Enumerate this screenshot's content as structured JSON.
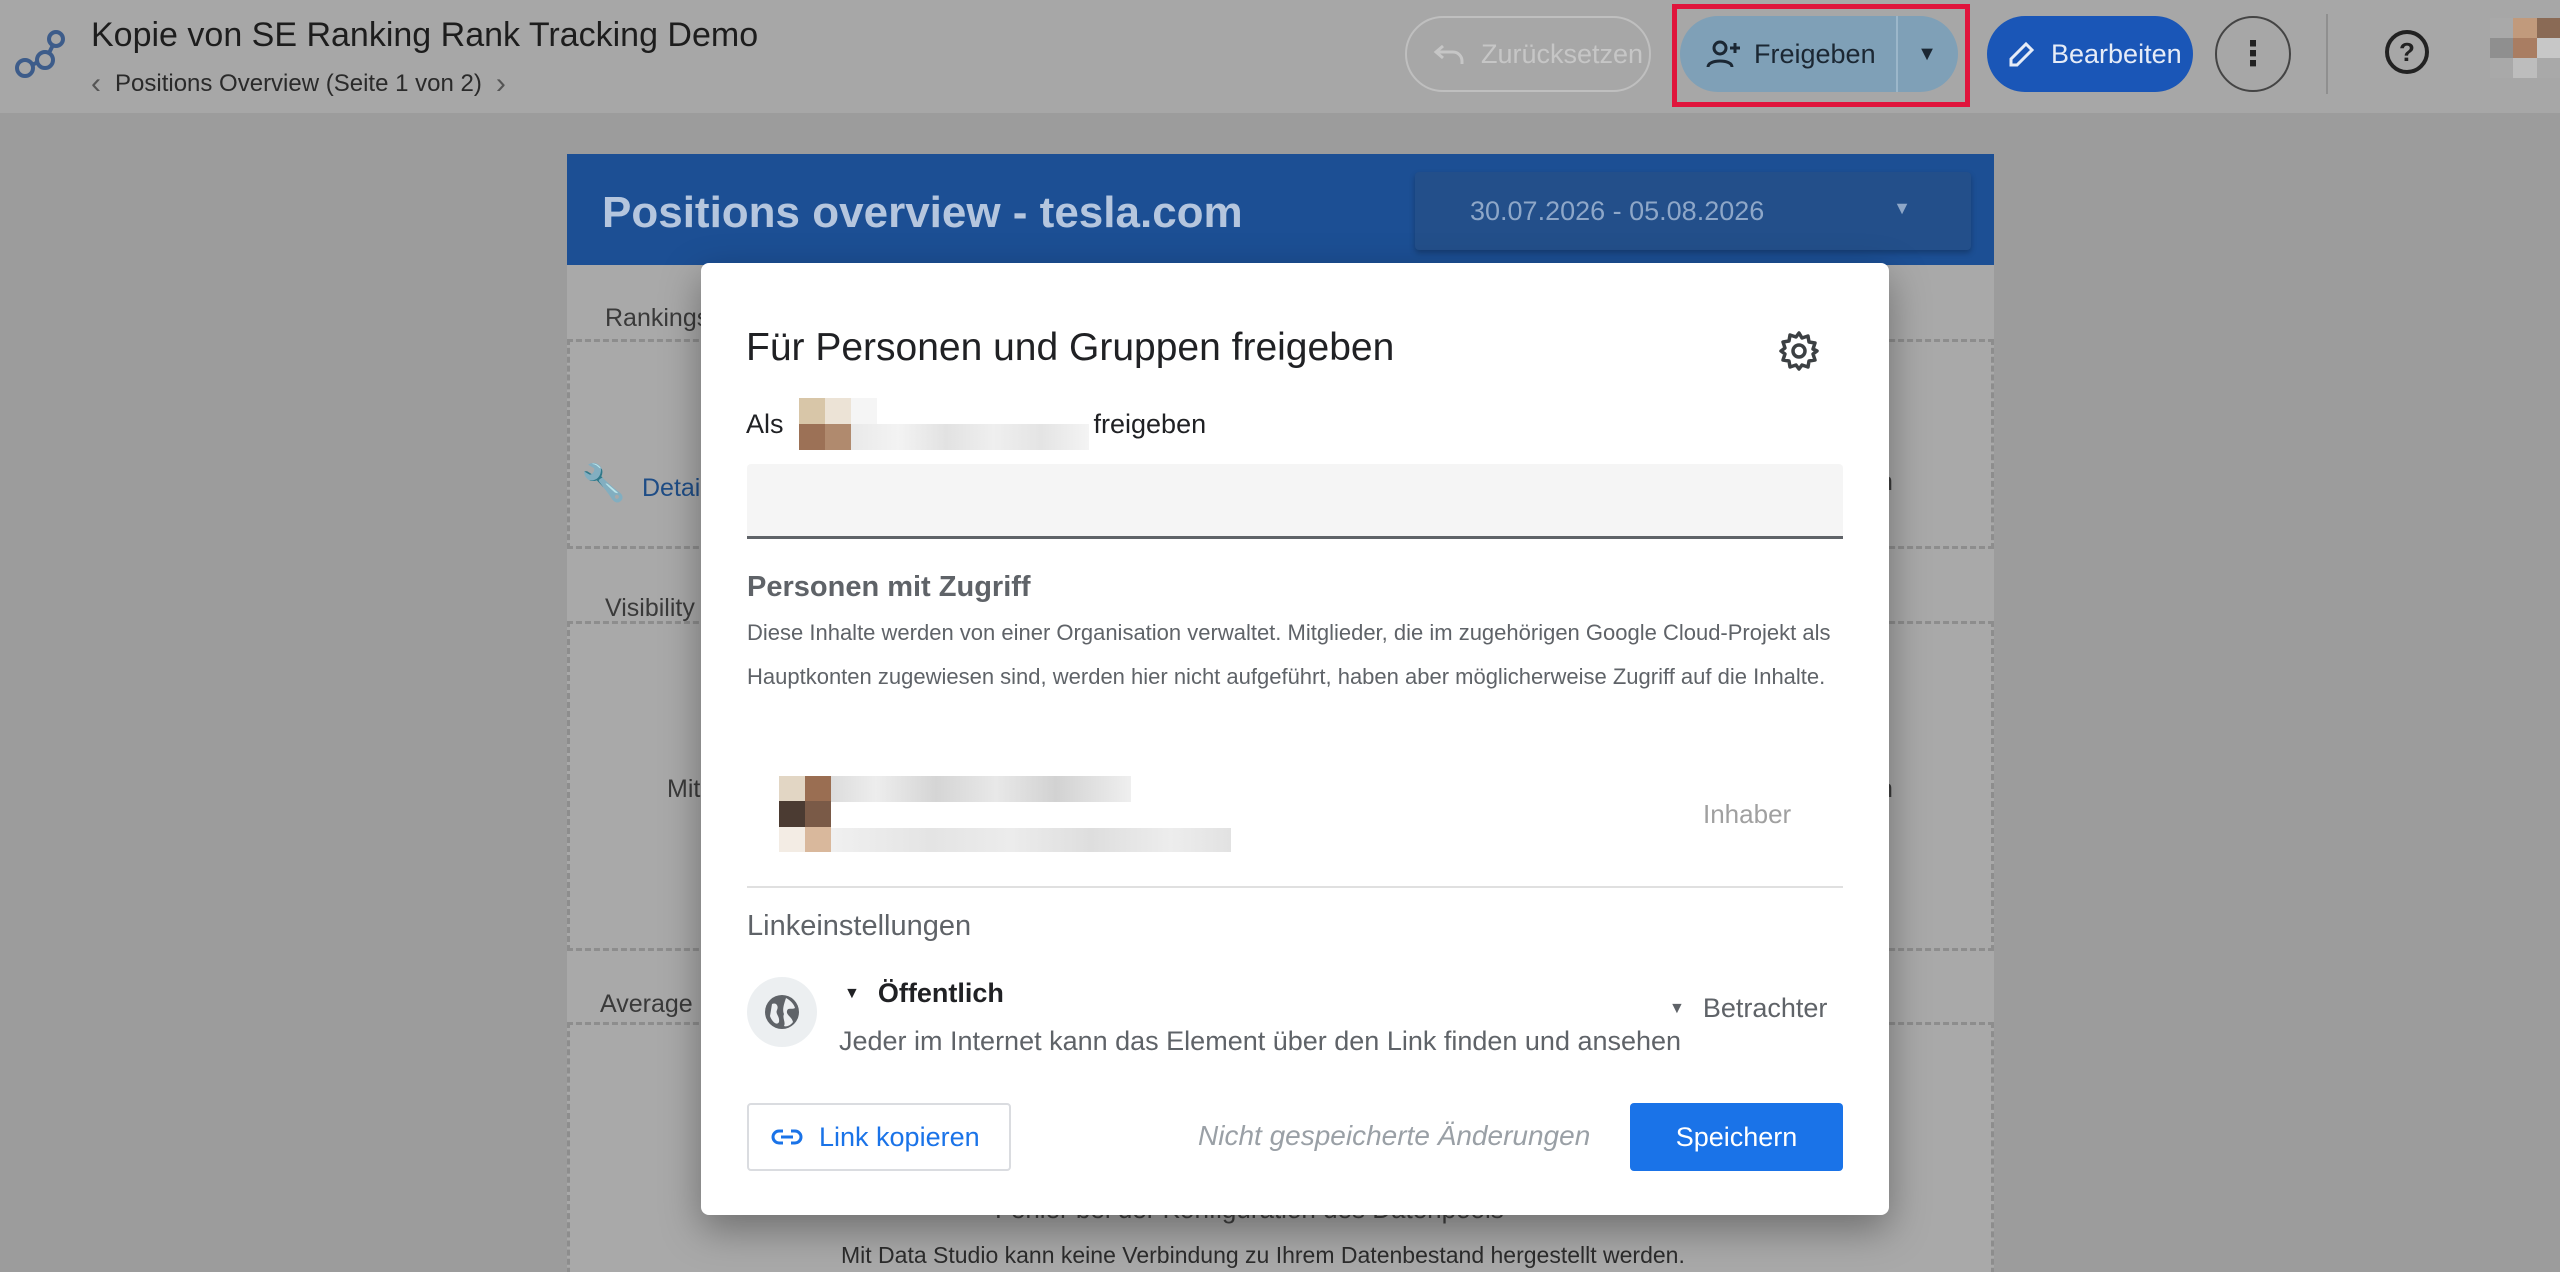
{
  "header": {
    "doc_title": "Kopie von SE Ranking Rank Tracking Demo",
    "page_label": "Positions Overview (Seite 1 von 2)",
    "reset_label": "Zurücksetzen",
    "share_label": "Freigeben",
    "edit_label": "Bearbeiten",
    "icons": {
      "logo": "data-studio-logo-icon",
      "prev": "chevron-left-icon",
      "next": "chevron-right-icon",
      "reset": "undo-icon",
      "share": "person-add-icon",
      "share_drop": "caret-down-icon",
      "edit": "pencil-icon",
      "more": "more-vert-icon",
      "help": "help-icon"
    }
  },
  "report": {
    "title": "Positions overview - tesla.com",
    "date_range": "30.07.2026 - 05.08.2026",
    "fragments": {
      "rankings": "Rankings",
      "details": "Detai",
      "visibility": "Visibility",
      "mit": "Mit",
      "average": "Average",
      "error_title": "Fehler bei der Konfiguration des Datenpools",
      "error_text": "Mit Data Studio kann keine Verbindung zu Ihrem Datenbestand hergestellt werden.",
      "right_n1": "n",
      "right_n2": "n"
    }
  },
  "share_dialog": {
    "title": "Für Personen und Gruppen freigeben",
    "as_prefix": "Als",
    "as_suffix": "freigeben",
    "people_title": "Personen mit Zugriff",
    "people_desc": "Diese Inhalte werden von einer Organisation verwaltet. Mitglieder, die im zugehörigen Google Cloud-Projekt als Hauptkonten zugewiesen sind, werden hier nicht aufgeführt, haben aber möglicherweise Zugriff auf die Inhalte.",
    "owner_role": "Inhaber",
    "link_settings_title": "Linkeinstellungen",
    "access_level": "Öffentlich",
    "access_desc": "Jeder im Internet kann das Element über den Link finden und ansehen",
    "link_role": "Betrachter",
    "copy_link_label": "Link kopieren",
    "unsaved_text": "Nicht gespeicherte Änderungen",
    "save_label": "Speichern",
    "icons": {
      "settings": "gear-icon",
      "globe": "globe-icon",
      "link": "link-icon",
      "access_caret": "caret-down-icon",
      "role_caret": "caret-down-icon"
    }
  },
  "colors": {
    "primary_blue": "#1a73e8",
    "highlight_red": "#e0143c",
    "banner_blue": "#1c4f94"
  }
}
